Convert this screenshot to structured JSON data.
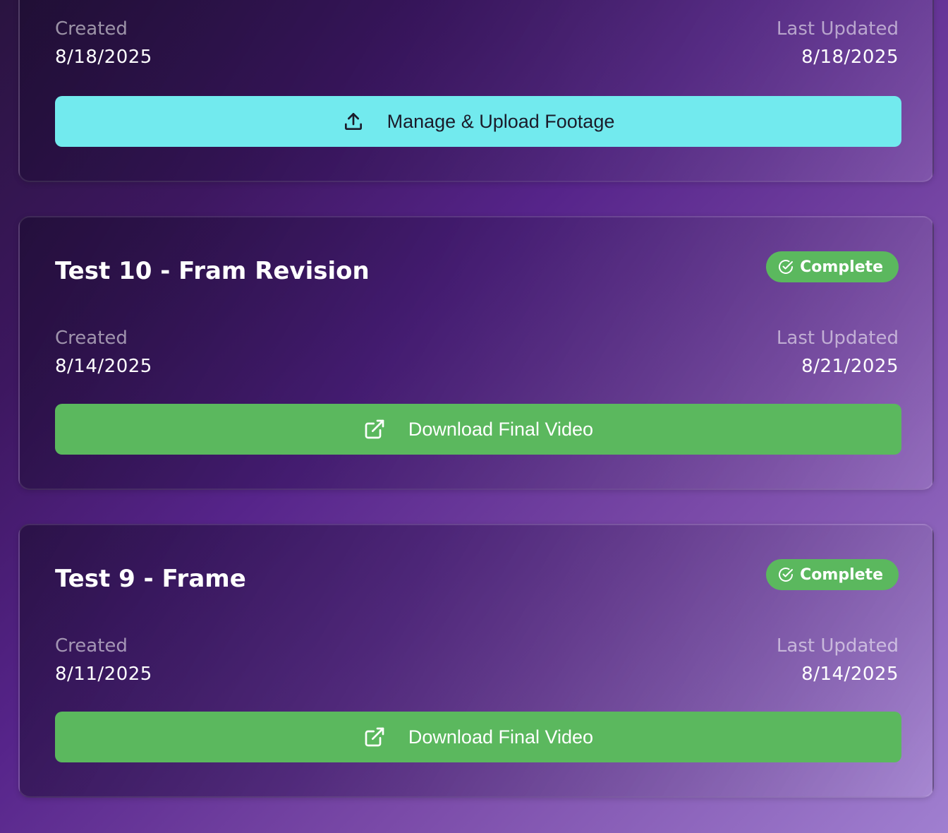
{
  "projects": [
    {
      "title": "",
      "status": "",
      "created_label": "Created",
      "created_value": "8/18/2025",
      "updated_label": "Last Updated",
      "updated_value": "8/18/2025",
      "action_label": "Manage & Upload Footage",
      "action_icon": "upload-icon",
      "action_color": "#72eaee"
    },
    {
      "title": "Test 10 - Fram Revision",
      "status": "Complete",
      "created_label": "Created",
      "created_value": "8/14/2025",
      "updated_label": "Last Updated",
      "updated_value": "8/21/2025",
      "action_label": "Download Final Video",
      "action_icon": "external-link-icon",
      "action_color": "#5bb85e"
    },
    {
      "title": "Test 9 - Frame",
      "status": "Complete",
      "created_label": "Created",
      "created_value": "8/11/2025",
      "updated_label": "Last Updated",
      "updated_value": "8/14/2025",
      "action_label": "Download Final Video",
      "action_icon": "external-link-icon",
      "action_color": "#5bb85e"
    }
  ],
  "colors": {
    "complete_badge": "#5bb85e",
    "upload_button": "#72eaee",
    "muted_text": "rgba(255,255,255,0.55)"
  }
}
